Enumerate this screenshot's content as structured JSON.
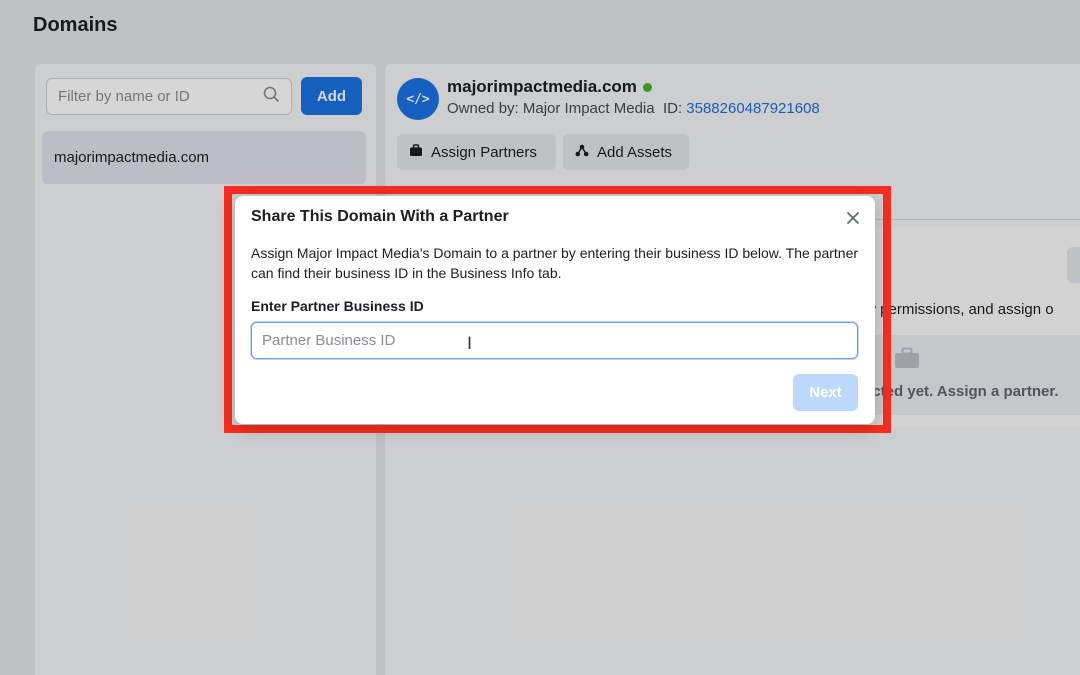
{
  "page": {
    "title": "Domains"
  },
  "left_panel": {
    "filter_placeholder": "Filter by name or ID",
    "add_label": "Add",
    "domains": [
      "majorimpactmedia.com"
    ]
  },
  "detail": {
    "avatar_glyph": "</>",
    "domain_name": "majorimpactmedia.com",
    "status_color": "#42b72a",
    "owned_by_label": "Owned by: Major Impact Media",
    "id_label": "ID:",
    "id_value": "3588260487921608",
    "assign_partners_label": "Assign Partners",
    "add_assets_label": "Add Assets",
    "card_desc_partial": "view permissions, and assign o",
    "empty_text_partial": "ected yet. Assign a partner."
  },
  "modal": {
    "title": "Share This Domain With a Partner",
    "description": "Assign Major Impact Media's Domain to a partner by entering their business ID below. The partner can find their business ID in the Business Info tab.",
    "field_label": "Enter Partner Business ID",
    "input_placeholder": "Partner Business ID",
    "input_value": "",
    "next_label": "Next",
    "highlight_color": "#f62d1f"
  },
  "colors": {
    "accent": "#1b74e4",
    "link": "#216fdb"
  }
}
